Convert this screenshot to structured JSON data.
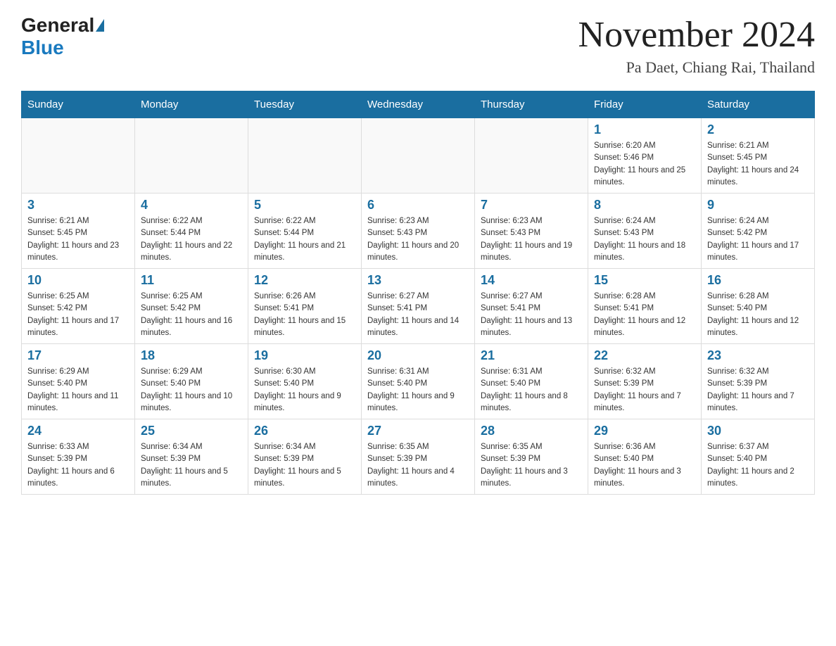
{
  "header": {
    "logo_general": "General",
    "logo_blue": "Blue",
    "title": "November 2024",
    "subtitle": "Pa Daet, Chiang Rai, Thailand"
  },
  "days_of_week": [
    "Sunday",
    "Monday",
    "Tuesday",
    "Wednesday",
    "Thursday",
    "Friday",
    "Saturday"
  ],
  "weeks": [
    [
      {
        "day": "",
        "info": ""
      },
      {
        "day": "",
        "info": ""
      },
      {
        "day": "",
        "info": ""
      },
      {
        "day": "",
        "info": ""
      },
      {
        "day": "",
        "info": ""
      },
      {
        "day": "1",
        "info": "Sunrise: 6:20 AM\nSunset: 5:46 PM\nDaylight: 11 hours and 25 minutes."
      },
      {
        "day": "2",
        "info": "Sunrise: 6:21 AM\nSunset: 5:45 PM\nDaylight: 11 hours and 24 minutes."
      }
    ],
    [
      {
        "day": "3",
        "info": "Sunrise: 6:21 AM\nSunset: 5:45 PM\nDaylight: 11 hours and 23 minutes."
      },
      {
        "day": "4",
        "info": "Sunrise: 6:22 AM\nSunset: 5:44 PM\nDaylight: 11 hours and 22 minutes."
      },
      {
        "day": "5",
        "info": "Sunrise: 6:22 AM\nSunset: 5:44 PM\nDaylight: 11 hours and 21 minutes."
      },
      {
        "day": "6",
        "info": "Sunrise: 6:23 AM\nSunset: 5:43 PM\nDaylight: 11 hours and 20 minutes."
      },
      {
        "day": "7",
        "info": "Sunrise: 6:23 AM\nSunset: 5:43 PM\nDaylight: 11 hours and 19 minutes."
      },
      {
        "day": "8",
        "info": "Sunrise: 6:24 AM\nSunset: 5:43 PM\nDaylight: 11 hours and 18 minutes."
      },
      {
        "day": "9",
        "info": "Sunrise: 6:24 AM\nSunset: 5:42 PM\nDaylight: 11 hours and 17 minutes."
      }
    ],
    [
      {
        "day": "10",
        "info": "Sunrise: 6:25 AM\nSunset: 5:42 PM\nDaylight: 11 hours and 17 minutes."
      },
      {
        "day": "11",
        "info": "Sunrise: 6:25 AM\nSunset: 5:42 PM\nDaylight: 11 hours and 16 minutes."
      },
      {
        "day": "12",
        "info": "Sunrise: 6:26 AM\nSunset: 5:41 PM\nDaylight: 11 hours and 15 minutes."
      },
      {
        "day": "13",
        "info": "Sunrise: 6:27 AM\nSunset: 5:41 PM\nDaylight: 11 hours and 14 minutes."
      },
      {
        "day": "14",
        "info": "Sunrise: 6:27 AM\nSunset: 5:41 PM\nDaylight: 11 hours and 13 minutes."
      },
      {
        "day": "15",
        "info": "Sunrise: 6:28 AM\nSunset: 5:41 PM\nDaylight: 11 hours and 12 minutes."
      },
      {
        "day": "16",
        "info": "Sunrise: 6:28 AM\nSunset: 5:40 PM\nDaylight: 11 hours and 12 minutes."
      }
    ],
    [
      {
        "day": "17",
        "info": "Sunrise: 6:29 AM\nSunset: 5:40 PM\nDaylight: 11 hours and 11 minutes."
      },
      {
        "day": "18",
        "info": "Sunrise: 6:29 AM\nSunset: 5:40 PM\nDaylight: 11 hours and 10 minutes."
      },
      {
        "day": "19",
        "info": "Sunrise: 6:30 AM\nSunset: 5:40 PM\nDaylight: 11 hours and 9 minutes."
      },
      {
        "day": "20",
        "info": "Sunrise: 6:31 AM\nSunset: 5:40 PM\nDaylight: 11 hours and 9 minutes."
      },
      {
        "day": "21",
        "info": "Sunrise: 6:31 AM\nSunset: 5:40 PM\nDaylight: 11 hours and 8 minutes."
      },
      {
        "day": "22",
        "info": "Sunrise: 6:32 AM\nSunset: 5:39 PM\nDaylight: 11 hours and 7 minutes."
      },
      {
        "day": "23",
        "info": "Sunrise: 6:32 AM\nSunset: 5:39 PM\nDaylight: 11 hours and 7 minutes."
      }
    ],
    [
      {
        "day": "24",
        "info": "Sunrise: 6:33 AM\nSunset: 5:39 PM\nDaylight: 11 hours and 6 minutes."
      },
      {
        "day": "25",
        "info": "Sunrise: 6:34 AM\nSunset: 5:39 PM\nDaylight: 11 hours and 5 minutes."
      },
      {
        "day": "26",
        "info": "Sunrise: 6:34 AM\nSunset: 5:39 PM\nDaylight: 11 hours and 5 minutes."
      },
      {
        "day": "27",
        "info": "Sunrise: 6:35 AM\nSunset: 5:39 PM\nDaylight: 11 hours and 4 minutes."
      },
      {
        "day": "28",
        "info": "Sunrise: 6:35 AM\nSunset: 5:39 PM\nDaylight: 11 hours and 3 minutes."
      },
      {
        "day": "29",
        "info": "Sunrise: 6:36 AM\nSunset: 5:40 PM\nDaylight: 11 hours and 3 minutes."
      },
      {
        "day": "30",
        "info": "Sunrise: 6:37 AM\nSunset: 5:40 PM\nDaylight: 11 hours and 2 minutes."
      }
    ]
  ]
}
